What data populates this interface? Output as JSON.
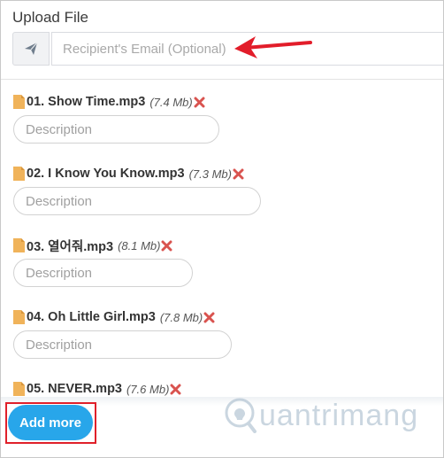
{
  "header": {
    "title": "Upload File"
  },
  "email": {
    "placeholder": "Recipient's Email (Optional)"
  },
  "files": [
    {
      "name": "01. Show Time.mp3",
      "size": "(7.4 Mb)",
      "description_placeholder": "Description"
    },
    {
      "name": "02. I Know You Know.mp3",
      "size": "(7.3 Mb)",
      "description_placeholder": "Description"
    },
    {
      "name": "03. 열어줘.mp3",
      "size": "(8.1 Mb)",
      "description_placeholder": "Description"
    },
    {
      "name": "04. Oh Little Girl.mp3",
      "size": "(7.8 Mb)",
      "description_placeholder": "Description"
    },
    {
      "name": "05. NEVER.mp3",
      "size": "(7.6 Mb)"
    }
  ],
  "actions": {
    "add_more_label": "Add more"
  },
  "watermark": {
    "text": "uantrimang"
  },
  "colors": {
    "accent": "#28a6ea",
    "remove": "#d9534f",
    "file_icon": "#f0b35a",
    "highlight": "#e0202a"
  }
}
